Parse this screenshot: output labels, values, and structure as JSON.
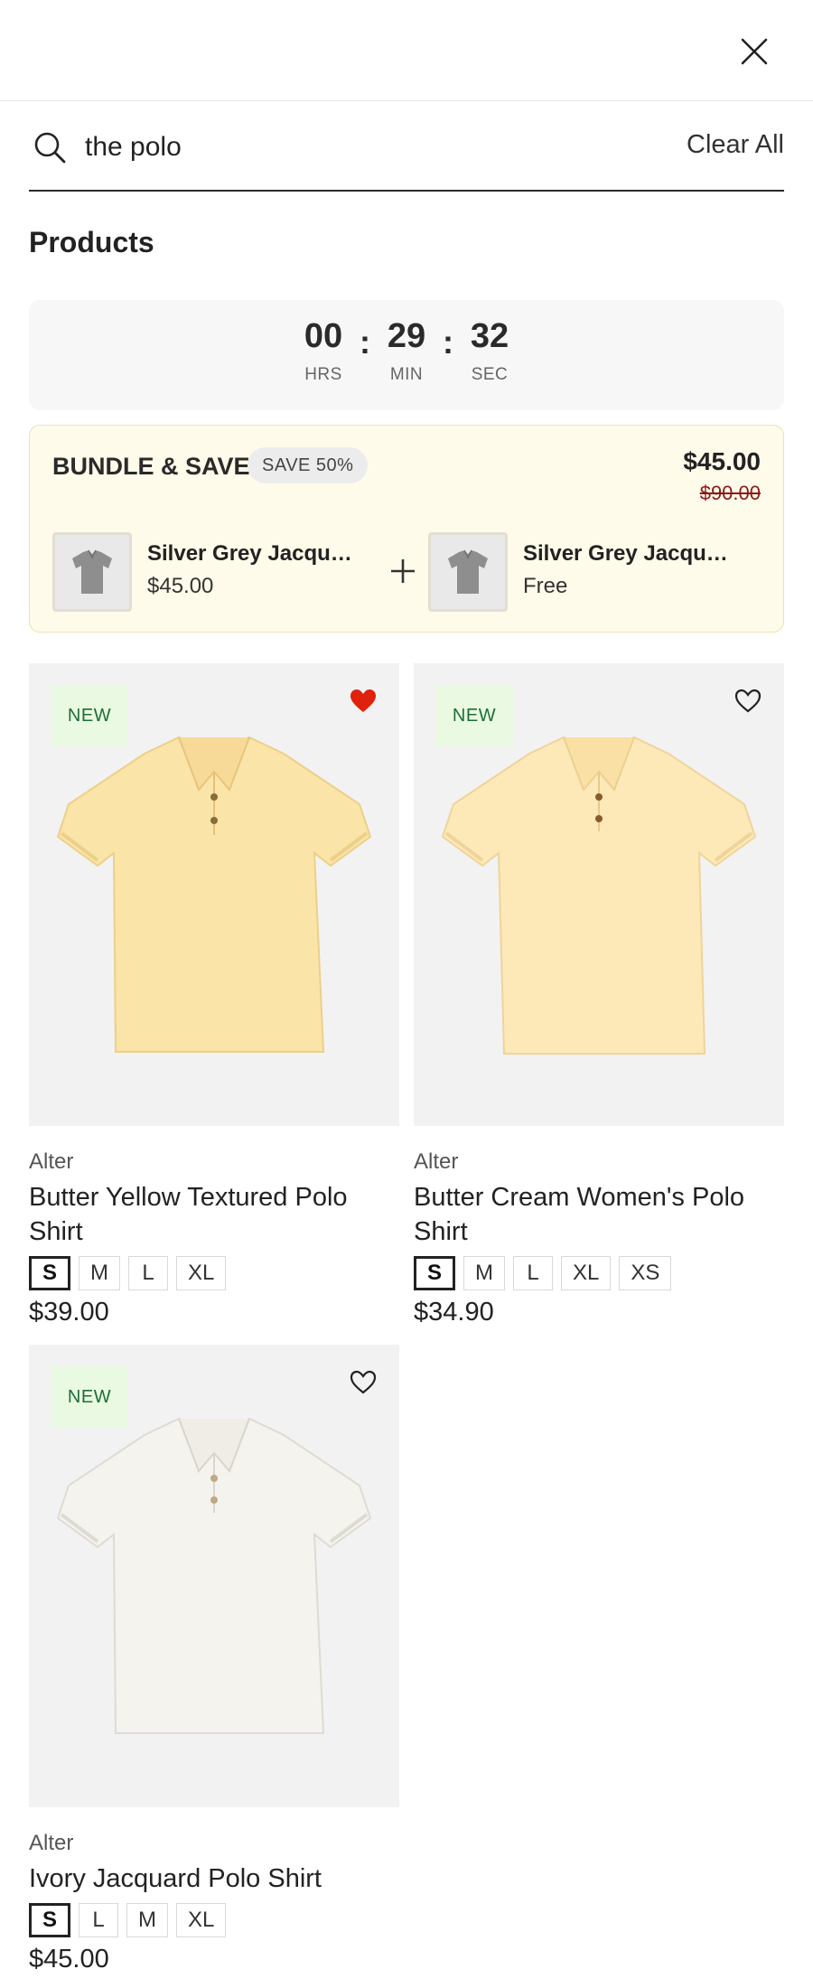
{
  "search": {
    "query": "the polo",
    "clear_label": "Clear All"
  },
  "section_title": "Products",
  "countdown": {
    "hours": "00",
    "minutes": "29",
    "seconds": "32",
    "hours_label": "HRS",
    "minutes_label": "MIN",
    "seconds_label": "SEC",
    "separator": ":"
  },
  "bundle": {
    "title": "BUNDLE & SAVE",
    "badge": "SAVE 50%",
    "price": "$45.00",
    "old_price": "$90.00",
    "items": [
      {
        "name": "Silver Grey Jacquard Polo Shirt",
        "price": "$45.00"
      },
      {
        "name": "Silver Grey Jacquard Polo Shirt",
        "price": "Free"
      }
    ]
  },
  "products": [
    {
      "badge": "NEW",
      "favorited": true,
      "brand": "Alter",
      "name": "Butter Yellow Textured Polo Shirt",
      "sizes": [
        "S",
        "M",
        "L",
        "XL"
      ],
      "selected_size": "S",
      "price": "$39.00",
      "shirt_color": "#fbe4a8"
    },
    {
      "badge": "NEW",
      "favorited": false,
      "brand": "Alter",
      "name": "Butter Cream Women's Polo Shirt",
      "sizes": [
        "S",
        "M",
        "L",
        "XL",
        "XS"
      ],
      "selected_size": "S",
      "price": "$34.90",
      "shirt_color": "#fde9b8"
    },
    {
      "badge": "NEW",
      "favorited": false,
      "brand": "Alter",
      "name": "Ivory Jacquard Polo Shirt",
      "sizes": [
        "S",
        "L",
        "M",
        "XL"
      ],
      "selected_size": "S",
      "price": "$45.00",
      "shirt_color": "#f5f3ee"
    }
  ],
  "colors": {
    "heart_active": "#e0210b",
    "new_badge_bg": "#eaf9e1",
    "new_badge_text": "#1f6d3b",
    "bundle_bg": "#fefbea"
  }
}
